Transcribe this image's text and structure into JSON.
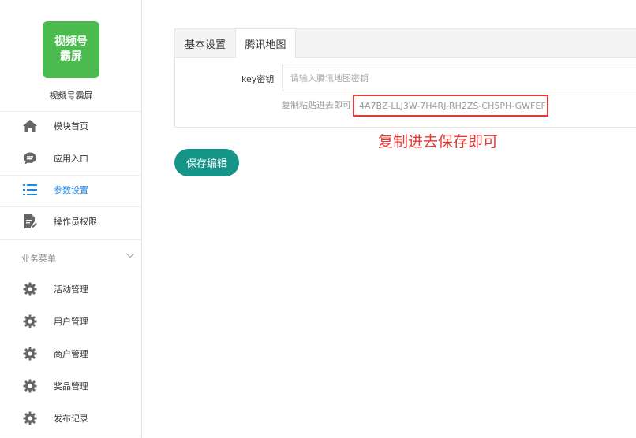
{
  "sidebar": {
    "logo": {
      "line1": "视频号",
      "line2": "霸屏",
      "color": "#4cbb4f"
    },
    "app_name": "视频号霸屏",
    "items": [
      {
        "label": "模块首页",
        "icon": "home-icon"
      },
      {
        "label": "应用入口",
        "icon": "chat-bubble-icon"
      },
      {
        "label": "参数设置",
        "icon": "list-settings-icon",
        "active": true
      },
      {
        "label": "操作员权限",
        "icon": "document-edit-icon"
      }
    ],
    "section_title": "业务菜单",
    "business_items": [
      {
        "label": "活动管理",
        "icon": "gear-icon"
      },
      {
        "label": "用户管理",
        "icon": "gear-icon"
      },
      {
        "label": "商户管理",
        "icon": "gear-icon"
      },
      {
        "label": "奖品管理",
        "icon": "gear-icon"
      },
      {
        "label": "发布记录",
        "icon": "gear-icon"
      }
    ]
  },
  "main": {
    "tabs": [
      {
        "label": "基本设置",
        "active": false
      },
      {
        "label": "腾讯地图",
        "active": true
      }
    ],
    "key_field": {
      "label": "key密钥",
      "placeholder": "请输入腾讯地图密钥",
      "value": ""
    },
    "hint": "复制粘贴进去即可",
    "sample_key": "4A7BZ-LLJ3W-7H4RJ-RH2ZS-CH5PH-GWFEF",
    "annotation": "复制进去保存即可",
    "save_label": "保存编辑"
  },
  "colors": {
    "accent": "#1e88e5",
    "button": "#159488",
    "highlight": "#e53935"
  }
}
